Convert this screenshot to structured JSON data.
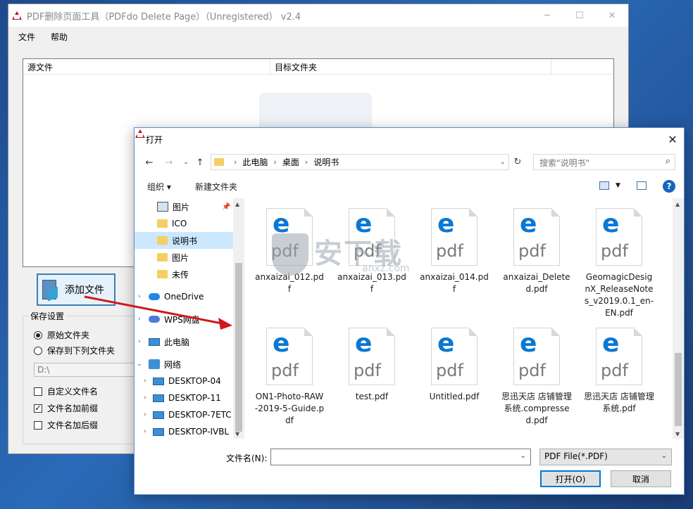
{
  "main_window": {
    "title": "PDF删除页面工具（PDFdo Delete Page）（Unregistered） v2.4",
    "menu": [
      "文件",
      "帮助"
    ],
    "list_columns": [
      "源文件",
      "目标文件夹"
    ],
    "add_button": "添加文件",
    "save_settings": {
      "legend": "保存设置",
      "options": [
        {
          "label": "原始文件夹",
          "selected": true
        },
        {
          "label": "保存到下列文件夹",
          "selected": false
        }
      ],
      "path": "D:\\",
      "checkboxes": [
        {
          "label": "自定义文件名",
          "checked": false
        },
        {
          "label": "文件名加前缀",
          "checked": true
        },
        {
          "label": "文件名加后缀",
          "checked": false
        }
      ]
    }
  },
  "dialog": {
    "title": "打开",
    "breadcrumb": [
      "此电脑",
      "桌面",
      "说明书"
    ],
    "search_placeholder": "搜索\"说明书\"",
    "toolbar": {
      "organize": "组织 ▾",
      "new_folder": "新建文件夹"
    },
    "nav": [
      {
        "label": "图片",
        "icon": "picture-icon"
      },
      {
        "label": "ICO",
        "icon": "folder-icon"
      },
      {
        "label": "说明书",
        "icon": "folder-icon",
        "selected": true
      },
      {
        "label": "图片",
        "icon": "folder-icon"
      },
      {
        "label": "未传",
        "icon": "folder-icon"
      },
      {
        "label": "OneDrive",
        "icon": "onedrive-icon"
      },
      {
        "label": "WPS网盘",
        "icon": "wps-cloud-icon"
      },
      {
        "label": "此电脑",
        "icon": "computer-icon"
      },
      {
        "label": "网络",
        "icon": "network-icon"
      },
      {
        "label": "DESKTOP-04",
        "icon": "computer-icon"
      },
      {
        "label": "DESKTOP-11",
        "icon": "computer-icon"
      },
      {
        "label": "DESKTOP-7ETC",
        "icon": "computer-icon"
      },
      {
        "label": "DESKTOP-IVBL",
        "icon": "computer-icon"
      }
    ],
    "files": [
      "anxaizai_012.pdf",
      "anxaizai_013.pdf",
      "anxaizai_014.pdf",
      "anxaizai_Deleted.pdf",
      "GeomagicDesignX_ReleaseNotes_v2019.0.1_en-EN.pdf",
      "ON1-Photo-RAW-2019-5-Guide.pdf",
      "test.pdf",
      "Untitled.pdf",
      "思迅天店 店铺管理系统.compressed.pdf",
      "思迅天店 店铺管理系统.pdf"
    ],
    "pdf_icon_glyph": "e",
    "pdf_icon_text": "pdf",
    "filename_label": "文件名(N):",
    "filename_value": "",
    "filetype": "PDF File(*.PDF)",
    "open_button": "打开(O)",
    "cancel_button": "取消"
  },
  "watermark": {
    "title": "安下载",
    "sub": "anxz.com"
  },
  "colors": {
    "accent": "#0078d7",
    "arrow": "#d0191c",
    "pdf_blue": "#0a78d4"
  }
}
